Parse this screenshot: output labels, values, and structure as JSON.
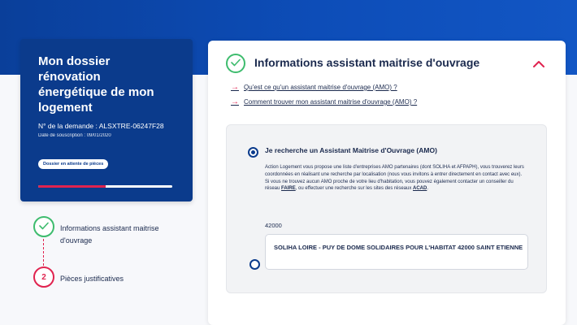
{
  "dossier": {
    "title": "Mon dossier rénovation énergétique de mon logement",
    "request_number": "N° de la demande : ALSXTRE-06247F28",
    "subscription_date": "Date de souscription : 09/01/2020",
    "status_badge": "Dossier en attente de pièces",
    "progress_fraction": 0.5
  },
  "steps": [
    {
      "label": "Informations assistant maitrise d'ouvrage",
      "state": "done",
      "icon": "check-icon"
    },
    {
      "label": "Pièces justificatives",
      "number": "2",
      "state": "pending"
    }
  ],
  "section": {
    "title": "Informations assistant maitrise d'ouvrage",
    "help_links": [
      "Qu'est ce qu'un assistant maitrise d'ouvrage (AMO) ?",
      "Comment trouver mon assistant maitrise d'ouvrage (AMO) ?"
    ],
    "option": {
      "label": "Je recherche un Assistant Maitrise d'Ouvrage (AMO)",
      "desc_part1": "Action Logement vous propose une liste d'entreprises AMO partenaires (dont SOLIHA et AFPAPH), vous trouverez leurs coordonnées en réalisant une recherche par localisation (nous vous invitons à entrer directement en contact avec eux).",
      "desc_part2": "Si vous ne trouvez aucun AMO proche de votre lieu d'habitation, vous pouvez également contacter un conseiller du réseau",
      "faire_link": "FAIRE",
      "desc_part3": ", ou effectuer une recherche sur les sites des réseaux",
      "acad_link": "ACAD",
      "desc_part4": ".",
      "postcode": "42000",
      "amo_result": "SOLIHA LOIRE - PUY DE DOME SOLIDAIRES POUR L'HABITAT 42000 SAINT ETIENNE"
    }
  },
  "colors": {
    "brand_blue": "#0b3b8c",
    "accent_red": "#e0234f",
    "success_green": "#3ebc6e"
  }
}
